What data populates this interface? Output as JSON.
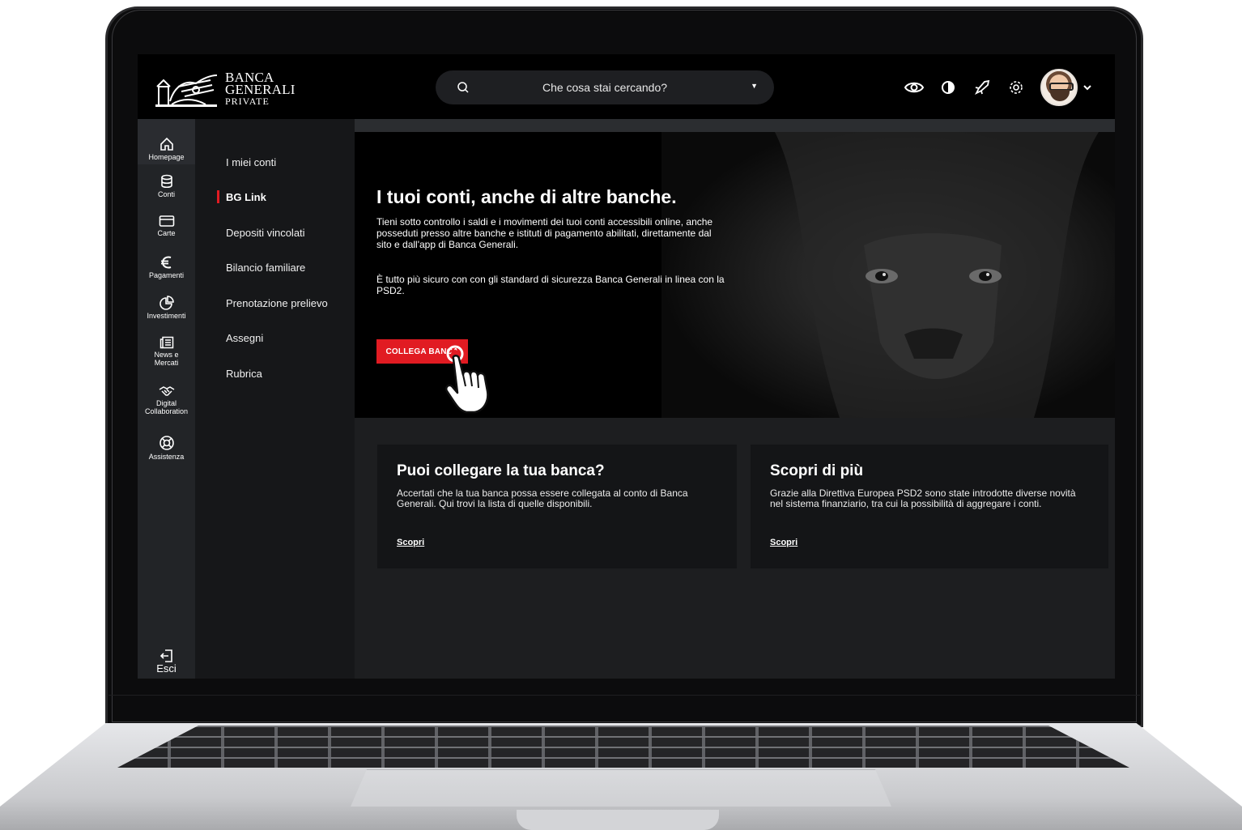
{
  "brand": {
    "line1": "BANCA",
    "line2": "GENERALI",
    "line3": "PRIVATE",
    "accent_color": "#e11b22"
  },
  "search": {
    "placeholder": "Che cosa stai cercando?",
    "icon": "search-icon"
  },
  "toolbar": {
    "icons": [
      "eye-icon",
      "contrast-icon",
      "rocket-icon",
      "gear-icon",
      "avatar",
      "chevron-down-icon"
    ]
  },
  "rail": {
    "items": [
      {
        "label": "Homepage",
        "icon": "home-icon"
      },
      {
        "label": "Conti",
        "icon": "database-icon"
      },
      {
        "label": "Carte",
        "icon": "card-icon"
      },
      {
        "label": "Pagamenti",
        "icon": "euro-icon"
      },
      {
        "label": "Investimenti",
        "icon": "pie-chart-icon"
      },
      {
        "label_1": "News e",
        "label_2": "Mercati",
        "icon": "newspaper-icon"
      },
      {
        "label_1": "Digital",
        "label_2": "Collaboration",
        "icon": "handshake-icon"
      },
      {
        "label": "Assistenza",
        "icon": "lifebuoy-icon"
      }
    ],
    "exit_label": "Esci"
  },
  "submenu": {
    "items": [
      "I miei conti",
      "BG Link",
      "Depositi vincolati",
      "Bilancio familiare",
      "Prenotazione prelievo",
      "Assegni",
      "Rubrica"
    ],
    "active": "BG Link"
  },
  "hero": {
    "title": "I tuoi conti, anche di altre banche.",
    "text1": "Tieni sotto controllo i saldi e i movimenti dei tuoi conti accessibili online, anche posseduti presso altre banche e istituti di pagamento abilitati, direttamente dal sito e dall'app di Banca Generali.",
    "text2": "È tutto più sicuro con con gli standard di sicurezza Banca Generali in linea con la PSD2.",
    "cta": "COLLEGA BANCA"
  },
  "cards": [
    {
      "title": "Puoi collegare la tua banca?",
      "text": "Accertati che la tua banca possa essere collegata al conto di Banca Generali. Qui trovi la lista di quelle disponibili.",
      "link": "Scopri"
    },
    {
      "title": "Scopri di più",
      "text": "Grazie alla Direttiva Europea PSD2 sono state introdotte diverse novità nel sistema finanziario, tra cui la possibilità di aggregare i conti.",
      "link": "Scopri"
    }
  ]
}
